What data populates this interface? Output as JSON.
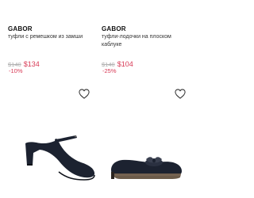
{
  "products": [
    {
      "brand": "GABOR",
      "title": "туфли с ремешком из замши",
      "old_price": "$140",
      "new_price": "$134",
      "discount": "-10%",
      "icon": "heart-icon"
    },
    {
      "brand": "GABOR",
      "title": "туфли-лодочки на плоском каблуке",
      "old_price": "$140",
      "new_price": "$104",
      "discount": "-25%",
      "icon": "heart-icon"
    }
  ],
  "colors": {
    "sale": "#d83a56",
    "old_price": "#b0b0b0",
    "shoe": "#1c2230"
  }
}
